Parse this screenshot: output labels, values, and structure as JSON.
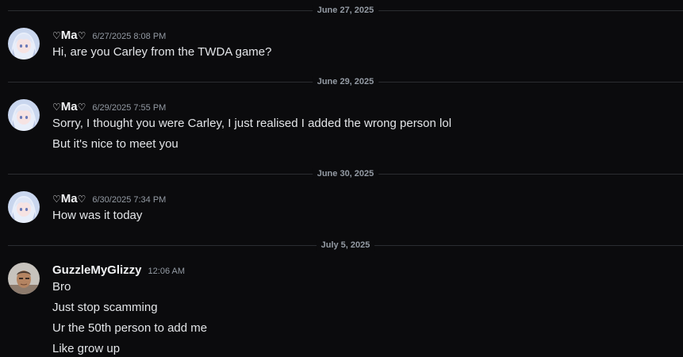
{
  "dividers": [
    {
      "label": "June 27, 2025"
    },
    {
      "label": "June 29, 2025"
    },
    {
      "label": "June 30, 2025"
    },
    {
      "label": "July 5, 2025"
    }
  ],
  "users": {
    "ma": {
      "heart_left": "♡",
      "name": "Ma",
      "heart_right": "♡",
      "avatar": "anime-girl-avatar"
    },
    "guzzle": {
      "name": "GuzzleMyGlizzy",
      "avatar": "person-photo-avatar"
    }
  },
  "messages": [
    {
      "author": "ma",
      "timestamp": "6/27/2025 8:08 PM",
      "lines": [
        "Hi, are you Carley from the TWDA game?"
      ]
    },
    {
      "author": "ma",
      "timestamp": "6/29/2025 7:55 PM",
      "lines": [
        "Sorry, I thought you were Carley, I just realised I added the wrong person lol",
        "But it's nice to meet you"
      ]
    },
    {
      "author": "ma",
      "timestamp": "6/30/2025 7:34 PM",
      "lines": [
        "How was it today"
      ]
    },
    {
      "author": "guzzle",
      "timestamp": "12:06 AM",
      "lines": [
        "Bro",
        "Just stop scamming",
        "Ur the 50th person to add me",
        "Like grow up"
      ]
    }
  ],
  "colors": {
    "background": "#0b0b0d",
    "divider": "#2b2d31",
    "timestamp": "#949ba4",
    "text": "#e3e5e8"
  }
}
